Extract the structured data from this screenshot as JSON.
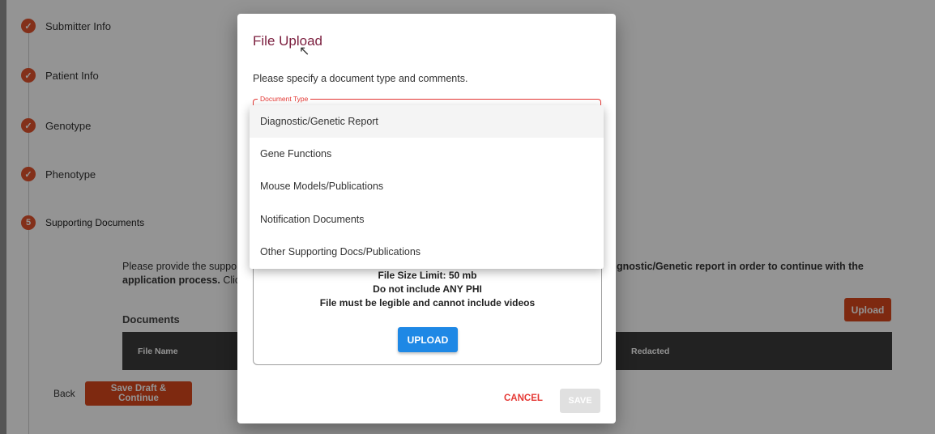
{
  "stepper": {
    "steps": [
      {
        "label": "Submitter Info",
        "icon": "check-icon"
      },
      {
        "label": "Patient Info",
        "icon": "check-icon"
      },
      {
        "label": "Genotype",
        "icon": "check-icon"
      },
      {
        "label": "Phenotype",
        "icon": "check-icon"
      },
      {
        "label": "Supporting Documents",
        "number": "5"
      }
    ]
  },
  "content": {
    "instruction_left": "Please provide the suppo",
    "instruction_right": "gnostic/Genetic report in order to continue with the",
    "instruction_line2_bold": "application process.",
    "instruction_line2_rest": " Click",
    "documents_title": "Documents",
    "upload_label": "Upload",
    "table_headers": [
      "File Name",
      "Redacted"
    ]
  },
  "footer": {
    "back_label": "Back",
    "save_draft_label": "Save Draft & Continue"
  },
  "modal": {
    "title": "File Upload",
    "description": "Please specify a document type and comments.",
    "document_type_label": "Document Type",
    "dropzone_lines": [
      "File Size Limit: 50 mb",
      "Do not include ANY PHI",
      "File must be legible and cannot include videos"
    ],
    "upload_button": "UPLOAD",
    "cancel_label": "CANCEL",
    "save_label": "SAVE"
  },
  "dropdown": {
    "options": [
      "Diagnostic/Genetic Report",
      "Gene Functions",
      "Mouse Models/Publications",
      "Notification Documents",
      "Other Supporting Docs/Publications"
    ],
    "selected_index": 0
  },
  "colors": {
    "accent_orange": "#d9471c",
    "step_icon": "#e2532d",
    "modal_title": "#7b1e3e",
    "error_red": "#e53935",
    "primary_blue": "#1e88e5",
    "table_header": "#3c3c3c"
  }
}
